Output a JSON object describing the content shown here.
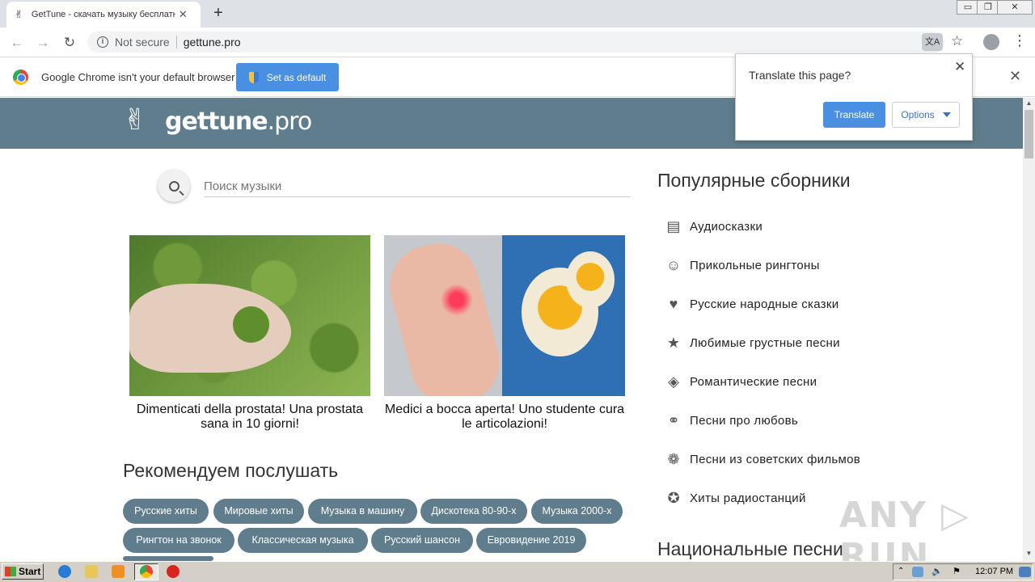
{
  "browser": {
    "tab_title": "GetTune - скачать музыку бесплатно",
    "tab_close": "✕",
    "new_tab": "+",
    "omnibox": {
      "security": "Not secure",
      "url": "gettune.pro"
    },
    "window_buttons": [
      "▭",
      "❐",
      "✕"
    ]
  },
  "infobar": {
    "text": "Google Chrome isn't your default browser",
    "button_label": "Set as default",
    "close": "✕"
  },
  "translate_popup": {
    "question": "Translate this page?",
    "translate_label": "Translate",
    "options_label": "Options",
    "close": "✕"
  },
  "site": {
    "logo": {
      "name": "gettune",
      "tld": ".pro"
    },
    "search": {
      "placeholder": "Поиск музыки"
    },
    "ads": [
      {
        "title": "Dimenticati della prostata! Una prostata sana in 10 giorni!"
      },
      {
        "title": "Medici a bocca aperta! Uno studente cura le articolazioni!"
      }
    ],
    "recommended": {
      "title": "Рекомендуем послушать",
      "tags": [
        "Русские хиты",
        "Мировые хиты",
        "Музыка в машину",
        "Дискотека 80-90-х",
        "Музыка 2000-х",
        "Рингтон на звонок",
        "Классическая музыка",
        "Русский шансон",
        "Евровидение 2019"
      ]
    },
    "sidebar": {
      "title": "Популярные сборники",
      "items": [
        {
          "label": "Аудиосказки",
          "icon": "cake-icon"
        },
        {
          "label": "Прикольные рингтоны",
          "icon": "smiley-icon"
        },
        {
          "label": "Русские народные сказки",
          "icon": "heart-icon"
        },
        {
          "label": "Любимые грустные песни",
          "icon": "star-icon"
        },
        {
          "label": "Романтические песни",
          "icon": "tag-icon"
        },
        {
          "label": "Песни про любовь",
          "icon": "motorcycle-icon"
        },
        {
          "label": "Песни из советских фильмов",
          "icon": "paw-icon"
        },
        {
          "label": "Хиты радиостанций",
          "icon": "badge-star-icon"
        }
      ],
      "title2": "Национальные песни"
    }
  },
  "watermark": "ANY ▷ RUN",
  "taskbar": {
    "start_label": "Start",
    "clock": "12:07 PM"
  }
}
